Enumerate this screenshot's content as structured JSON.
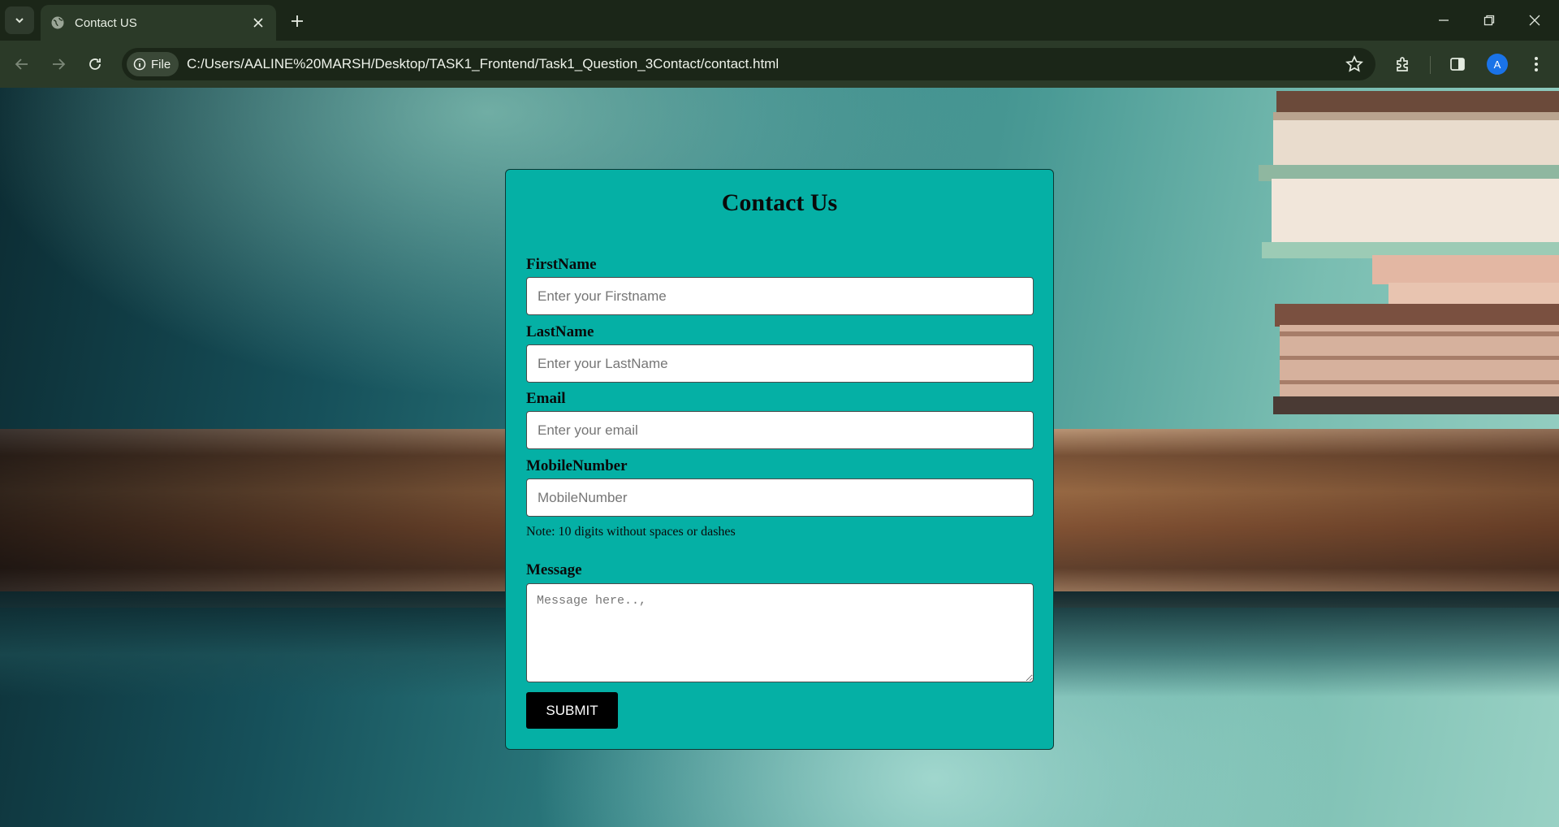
{
  "browser": {
    "tab_title": "Contact US",
    "chip_label": "File",
    "url": "C:/Users/AALINE%20MARSH/Desktop/TASK1_Frontend/Task1_Question_3Contact/contact.html",
    "avatar_letter": "A",
    "icons": [
      "chevron-down-icon",
      "globe-icon",
      "close-icon",
      "plus-icon",
      "minimize-icon",
      "restore-icon",
      "close-window-icon",
      "back-arrow-icon",
      "forward-arrow-icon",
      "reload-icon",
      "info-icon",
      "star-icon",
      "extensions-icon",
      "side-panel-icon",
      "more-vert-icon"
    ]
  },
  "form": {
    "title": "Contact Us",
    "firstname_label": "FirstName",
    "firstname_placeholder": "Enter your Firstname",
    "lastname_label": "LastName",
    "lastname_placeholder": "Enter your LastName",
    "email_label": "Email",
    "email_placeholder": "Enter your email",
    "mobile_label": "MobileNumber",
    "mobile_placeholder": "MobileNumber",
    "mobile_note": "Note: 10 digits without spaces or dashes",
    "message_label": "Message",
    "message_placeholder": "Message here..,",
    "submit_label": "SUBMIT"
  },
  "colors": {
    "card_bg": "#05b0a5",
    "submit_bg": "#000000",
    "toolbar_bg": "#2b3a28",
    "tabstrip_bg": "#1b2618"
  }
}
